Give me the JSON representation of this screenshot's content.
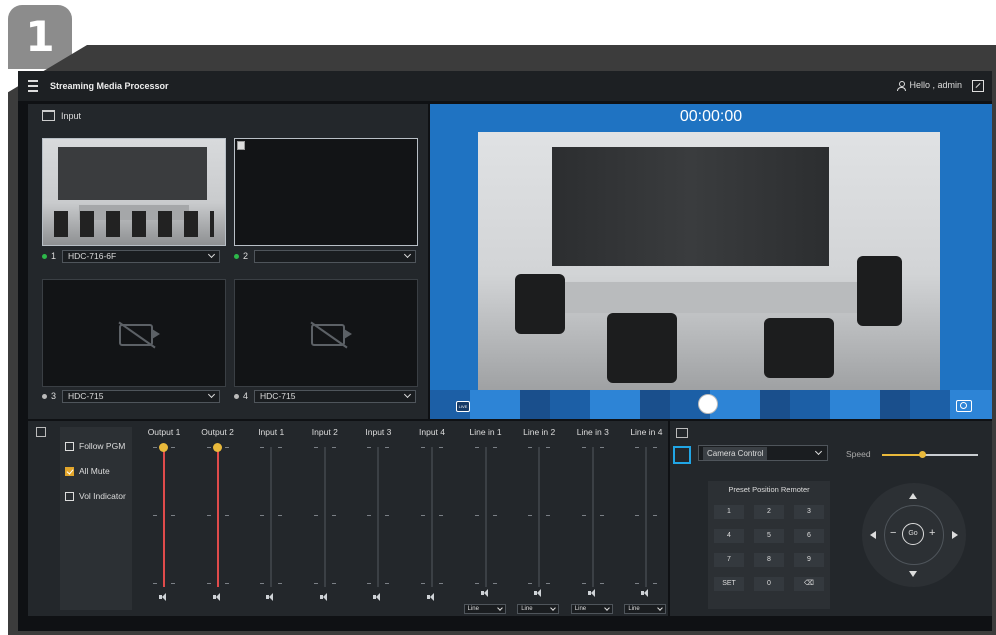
{
  "step_badge": "1",
  "app": {
    "title": "Streaming Media Processor",
    "greeting": "Hello , admin"
  },
  "input_panel": {
    "label": "Input",
    "sources": [
      {
        "num": "1",
        "name": "HDC-716-6F",
        "status_color": "#2db84a"
      },
      {
        "num": "2",
        "name": "",
        "status_color": "#2db84a"
      },
      {
        "num": "3",
        "name": "HDC-715",
        "status_color": "#bbbbbb"
      },
      {
        "num": "4",
        "name": "HDC-715",
        "status_color": "#bbbbbb"
      }
    ]
  },
  "preview": {
    "timer": "00:00:00",
    "live_label": "LIVE"
  },
  "audio": {
    "options": [
      {
        "label": "Follow PGM",
        "checked": false
      },
      {
        "label": "All Mute",
        "checked": true
      },
      {
        "label": "Vol Indicator",
        "checked": false
      }
    ],
    "channels": [
      {
        "label": "Output 1",
        "level": 1.0,
        "active": true
      },
      {
        "label": "Output 2",
        "level": 1.0,
        "active": true
      },
      {
        "label": "Input 1",
        "level": 0,
        "active": false
      },
      {
        "label": "Input 2",
        "level": 0,
        "active": false
      },
      {
        "label": "Input 3",
        "level": 0,
        "active": false
      },
      {
        "label": "Input 4",
        "level": 0,
        "active": false
      },
      {
        "label": "Line in 1",
        "level": 0,
        "active": false,
        "mode": "Line"
      },
      {
        "label": "Line in 2",
        "level": 0,
        "active": false,
        "mode": "Line"
      },
      {
        "label": "Line in 3",
        "level": 0,
        "active": false,
        "mode": "Line"
      },
      {
        "label": "Line in 4",
        "level": 0,
        "active": false,
        "mode": "Line"
      }
    ]
  },
  "camera": {
    "control_select": "Camera Control",
    "speed_label": "Speed",
    "speed_value": 0.42,
    "preset_title": "Preset Position Remoter",
    "preset_keys": [
      "1",
      "2",
      "3",
      "4",
      "5",
      "6",
      "7",
      "8",
      "9",
      "SET",
      "0",
      "⌫"
    ],
    "go_label": "Go",
    "zoom_out": "−",
    "zoom_in": "+"
  },
  "colors": {
    "accent": "#e9b93b",
    "level_red": "#e04b4b",
    "preview_blue": "#1f73c2",
    "highlight": "#21a6e6"
  }
}
